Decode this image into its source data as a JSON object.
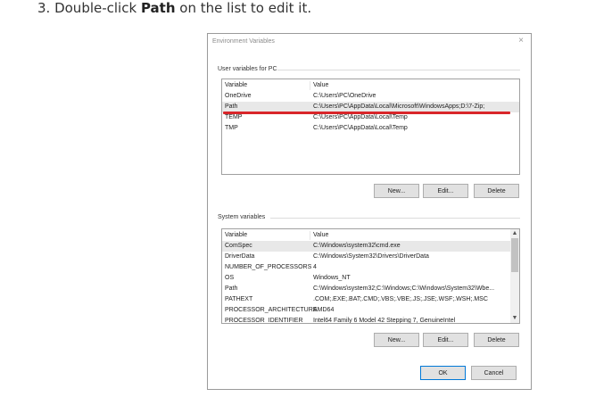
{
  "instruction": {
    "prefix": "3. Double-click ",
    "bold": "Path",
    "suffix": " on the list to edit it."
  },
  "dialog": {
    "title": "Environment Variables",
    "close_glyph": "×",
    "user_section_label": "User variables for PC",
    "system_section_label": "System variables",
    "column_variable": "Variable",
    "column_value": "Value",
    "user_vars": [
      {
        "name": "OneDrive",
        "value": "C:\\Users\\PC\\OneDrive"
      },
      {
        "name": "Path",
        "value": "C:\\Users\\PC\\AppData\\Local\\Microsoft\\WindowsApps;D:\\7-Zip;"
      },
      {
        "name": "TEMP",
        "value": "C:\\Users\\PC\\AppData\\Local\\Temp"
      },
      {
        "name": "TMP",
        "value": "C:\\Users\\PC\\AppData\\Local\\Temp"
      }
    ],
    "system_vars": [
      {
        "name": "ComSpec",
        "value": "C:\\Windows\\system32\\cmd.exe"
      },
      {
        "name": "DriverData",
        "value": "C:\\Windows\\System32\\Drivers\\DriverData"
      },
      {
        "name": "NUMBER_OF_PROCESSORS",
        "value": "4"
      },
      {
        "name": "OS",
        "value": "Windows_NT"
      },
      {
        "name": "Path",
        "value": "C:\\Windows\\system32;C:\\Windows;C:\\Windows\\System32\\Wbe..."
      },
      {
        "name": "PATHEXT",
        "value": ".COM;.EXE;.BAT;.CMD;.VBS;.VBE;.JS;.JSE;.WSF;.WSH;.MSC"
      },
      {
        "name": "PROCESSOR_ARCHITECTURE",
        "value": "AMD64"
      },
      {
        "name": "PROCESSOR_IDENTIFIER",
        "value": "Intel64 Family 6 Model 42 Stepping 7, GenuineIntel"
      }
    ],
    "user_buttons": {
      "new": "New...",
      "edit": "Edit...",
      "delete": "Delete"
    },
    "system_buttons": {
      "new": "New...",
      "edit": "Edit...",
      "delete": "Delete"
    },
    "ok": "OK",
    "cancel": "Cancel",
    "highlight_color": "#d9262a"
  }
}
